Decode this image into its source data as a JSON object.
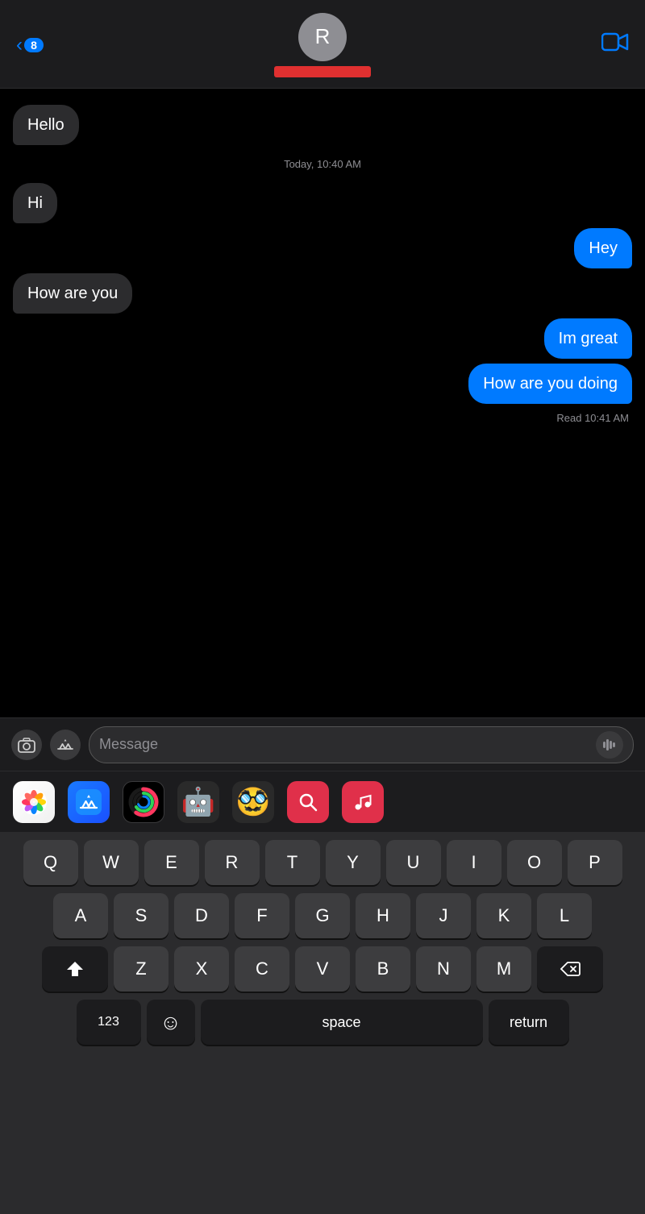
{
  "header": {
    "back_label": "8",
    "contact_initial": "R",
    "video_icon": "📹"
  },
  "messages": [
    {
      "id": 1,
      "type": "received",
      "text": "Hello"
    },
    {
      "id": 2,
      "type": "time",
      "text": "Today, 10:40 AM"
    },
    {
      "id": 3,
      "type": "received",
      "text": "Hi"
    },
    {
      "id": 4,
      "type": "sent",
      "text": "Hey"
    },
    {
      "id": 5,
      "type": "received",
      "text": "How are you"
    },
    {
      "id": 6,
      "type": "sent",
      "text": "Im great"
    },
    {
      "id": 7,
      "type": "sent",
      "text": "How are you doing"
    },
    {
      "id": 8,
      "type": "read",
      "text": "Read 10:41 AM"
    }
  ],
  "input": {
    "placeholder": "Message"
  },
  "app_icons": [
    {
      "name": "Photos",
      "type": "photos"
    },
    {
      "name": "App Store",
      "type": "appstore"
    },
    {
      "name": "Fitness",
      "type": "fitness"
    },
    {
      "name": "Memoji 1",
      "type": "memoji1"
    },
    {
      "name": "Memoji 2",
      "type": "memoji2"
    },
    {
      "name": "Search",
      "type": "search"
    },
    {
      "name": "Music",
      "type": "music"
    }
  ],
  "keyboard": {
    "rows": [
      [
        "Q",
        "W",
        "E",
        "R",
        "T",
        "Y",
        "U",
        "I",
        "O",
        "P"
      ],
      [
        "A",
        "S",
        "D",
        "F",
        "G",
        "H",
        "J",
        "K",
        "L"
      ],
      [
        "Z",
        "X",
        "C",
        "V",
        "B",
        "N",
        "M"
      ]
    ],
    "bottom": {
      "num_label": "123",
      "space_label": "space",
      "return_label": "return"
    }
  },
  "back_count": "8"
}
